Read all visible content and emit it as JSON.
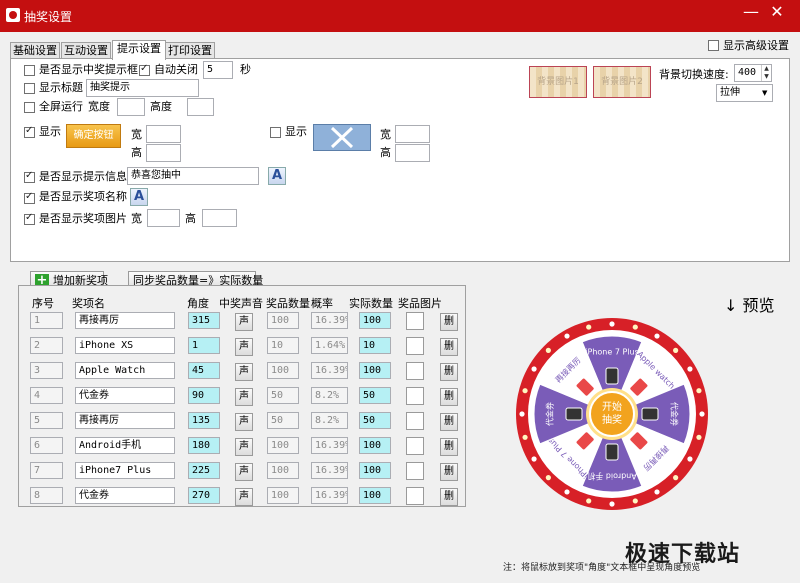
{
  "window": {
    "title": "抽奖设置",
    "minimize_icon": "minimize-icon",
    "close_icon": "close-icon"
  },
  "tabs": [
    {
      "label": "基础设置",
      "active": false
    },
    {
      "label": "互动设置",
      "active": false
    },
    {
      "label": "提示设置",
      "active": true
    },
    {
      "label": "打印设置",
      "active": false
    }
  ],
  "advanced": {
    "label": "显示高级设置",
    "checked": false
  },
  "settings": {
    "show_win_prompt": {
      "label": "是否显示中奖提示框",
      "checked": false
    },
    "auto_close": {
      "label": "自动关闭",
      "checked": true,
      "value": "5",
      "unit": "秒"
    },
    "show_title": {
      "label": "显示标题",
      "checked": false,
      "value": "抽奖提示"
    },
    "fullscreen": {
      "label": "全屏运行",
      "checked": false,
      "width_label": "宽度",
      "width_value": "",
      "height_label": "高度",
      "height_value": ""
    },
    "show_a": {
      "label": "显示",
      "checked": true,
      "button_text": "确定按钮",
      "width_label": "宽",
      "height_label": "高"
    },
    "show_b": {
      "label": "显示",
      "checked": false,
      "width_label": "宽",
      "height_label": "高"
    },
    "show_prompt_info": {
      "label": "是否显示提示信息",
      "checked": true,
      "value": "恭喜您抽中"
    },
    "show_prize_name": {
      "label": "是否显示奖项名称",
      "checked": true
    },
    "show_prize_image": {
      "label": "是否显示奖项图片",
      "checked": true,
      "width_label": "宽",
      "height_label": "高"
    },
    "bg_image_1": "背景图片1",
    "bg_image_2": "背景图片2",
    "bg_switch_speed": {
      "label": "背景切换速度:",
      "value": "400"
    },
    "stretch": {
      "value": "拉伸"
    }
  },
  "prize_list": {
    "add_button": "增加新奖项",
    "sync_button": "同步奖品数量=》实际数量",
    "headers": [
      "序号",
      "奖项名",
      "角度",
      "中奖声音",
      "奖品数量",
      "概率",
      "实际数量",
      "奖品图片"
    ],
    "sound_label": "声",
    "delete_label": "删",
    "rows": [
      {
        "no": "1",
        "name": "再接再厉",
        "angle": "315",
        "qty": "100",
        "prob": "16.39%",
        "actual": "100"
      },
      {
        "no": "2",
        "name": "iPhone XS",
        "angle": "1",
        "qty": "10",
        "prob": "1.64%",
        "actual": "10"
      },
      {
        "no": "3",
        "name": "Apple Watch",
        "angle": "45",
        "qty": "100",
        "prob": "16.39%",
        "actual": "100"
      },
      {
        "no": "4",
        "name": "代金券",
        "angle": "90",
        "qty": "50",
        "prob": "8.2%",
        "actual": "50"
      },
      {
        "no": "5",
        "name": "再接再厉",
        "angle": "135",
        "qty": "50",
        "prob": "8.2%",
        "actual": "50"
      },
      {
        "no": "6",
        "name": "Android手机",
        "angle": "180",
        "qty": "100",
        "prob": "16.39%",
        "actual": "100"
      },
      {
        "no": "7",
        "name": "iPhone7 Plus",
        "angle": "225",
        "qty": "100",
        "prob": "16.39%",
        "actual": "100"
      },
      {
        "no": "8",
        "name": "代金券",
        "angle": "270",
        "qty": "100",
        "prob": "16.39%",
        "actual": "100"
      }
    ]
  },
  "preview": {
    "label": "↓ 预览",
    "center_line1": "开始",
    "center_line2": "抽奖",
    "segments": [
      "iPhone 7 Plus",
      "Apple watch",
      "代金券",
      "再接再厉",
      "Android 手机",
      "iPhone 7 Plus",
      "代金券",
      "再接再厉"
    ]
  },
  "note": "注：将鼠标放到奖项\"角度\"文本框中呈现角度预览",
  "watermark": "极速下载站",
  "colors": {
    "title_bar": "#c40f10",
    "wheel_ring": "#d72027",
    "wheel_purple": "#7a5cb8",
    "cyan_cell": "#b6f0f4",
    "center_orange": "#f2a31e"
  }
}
